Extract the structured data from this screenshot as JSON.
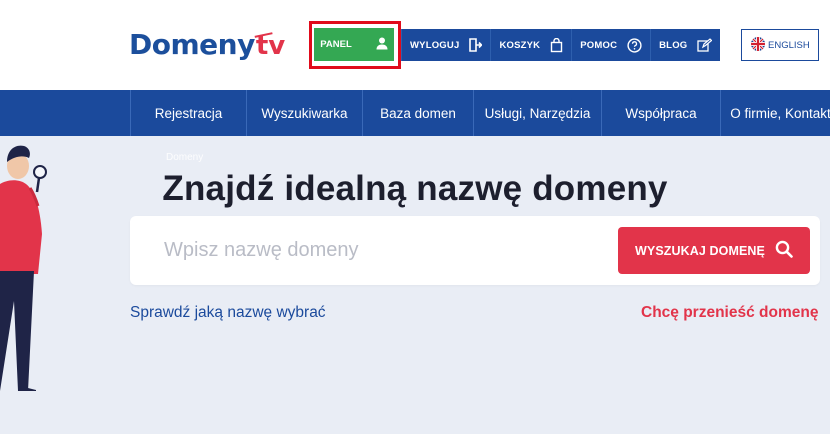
{
  "logo": {
    "text_main": "Domeny",
    "text_tv": "tv"
  },
  "topnav": {
    "panel": "PANEL",
    "items": [
      {
        "label": "WYLOGUJ",
        "icon": "logout-icon"
      },
      {
        "label": "KOSZYK",
        "icon": "cart-icon"
      },
      {
        "label": "POMOC",
        "icon": "help-icon"
      },
      {
        "label": "BLOG",
        "icon": "edit-icon"
      }
    ],
    "language": "ENGLISH"
  },
  "mainnav": {
    "items": [
      "Rejestracja",
      "Wyszukiwarka",
      "Baza domen",
      "Usługi, Narzędzia",
      "Współpraca",
      "O firmie, Kontakt"
    ]
  },
  "hero": {
    "breadcrumb": "Domeny",
    "title": "Znajdź idealną nazwę domeny",
    "search_placeholder": "Wpisz nazwę domeny",
    "search_button": "WYSZUKAJ DOMENĘ",
    "link_left": "Sprawdź jaką nazwę wybrać",
    "link_right": "Chcę przenieść domenę"
  },
  "colors": {
    "brand_blue": "#1b4a9c",
    "brand_red": "#e2344a",
    "panel_green": "#34a853",
    "highlight": "#e00b1b"
  }
}
